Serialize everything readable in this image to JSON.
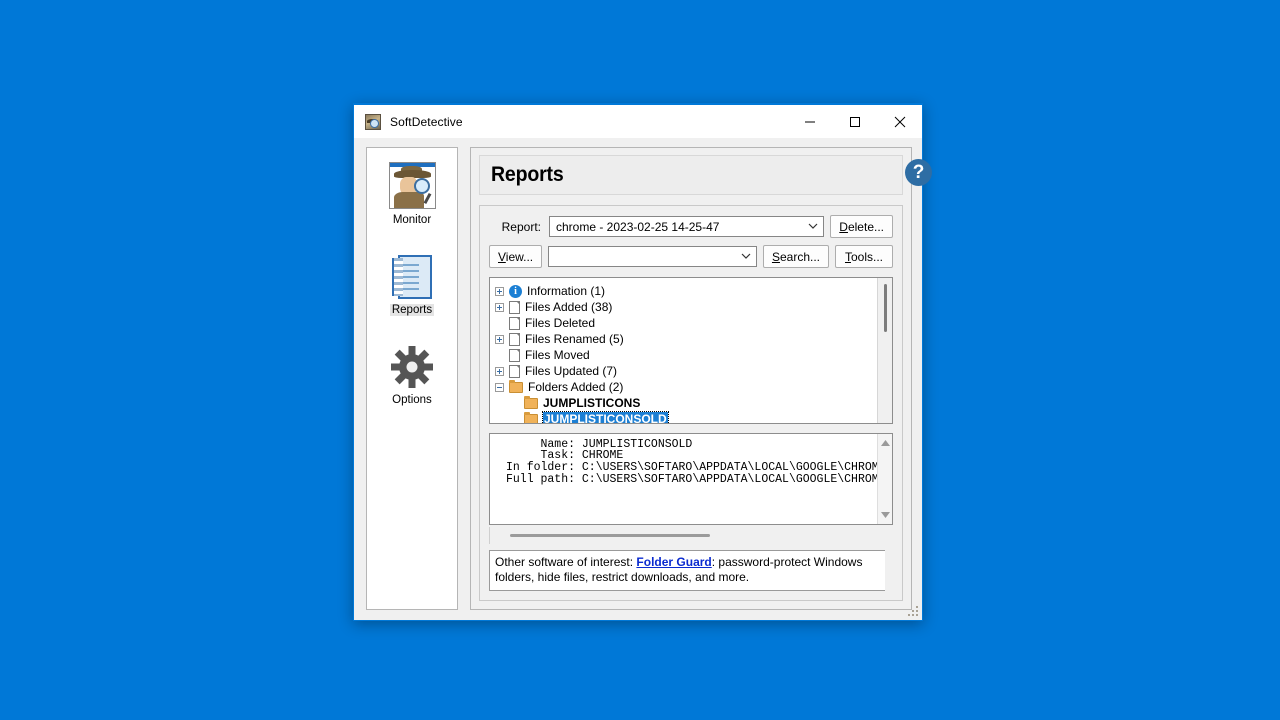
{
  "window": {
    "title": "SoftDetective",
    "icon": "detective-icon",
    "minimize_label": "Minimize",
    "maximize_label": "Maximize",
    "close_label": "Close"
  },
  "sidebar": {
    "items": [
      {
        "label": "Monitor",
        "icon": "detective-icon",
        "selected": false
      },
      {
        "label": "Reports",
        "icon": "notepad-icon",
        "selected": true
      },
      {
        "label": "Options",
        "icon": "gear-icon",
        "selected": false
      }
    ]
  },
  "header": {
    "title": "Reports",
    "help_label": "?"
  },
  "toolbar": {
    "report_label": "Report:",
    "report_value": "chrome - 2023-02-25 14-25-47",
    "delete_label": "Delete...",
    "view_label": "View...",
    "filter_value": "",
    "search_label": "Search...",
    "tools_label": "Tools..."
  },
  "tree": {
    "rows": [
      {
        "expander": "plus",
        "icon": "info-icon",
        "label": "Information (1)",
        "indent": 0,
        "bold": false,
        "selected": false
      },
      {
        "expander": "plus",
        "icon": "doc-icon",
        "label": "Files Added (38)",
        "indent": 0,
        "bold": false,
        "selected": false
      },
      {
        "expander": "none",
        "icon": "doc-icon",
        "label": "Files Deleted",
        "indent": 0,
        "bold": false,
        "selected": false
      },
      {
        "expander": "plus",
        "icon": "doc-icon",
        "label": "Files Renamed (5)",
        "indent": 0,
        "bold": false,
        "selected": false
      },
      {
        "expander": "none",
        "icon": "doc-icon",
        "label": "Files Moved",
        "indent": 0,
        "bold": false,
        "selected": false
      },
      {
        "expander": "plus",
        "icon": "doc-icon",
        "label": "Files Updated (7)",
        "indent": 0,
        "bold": false,
        "selected": false
      },
      {
        "expander": "minus",
        "icon": "folder-icon",
        "label": "Folders Added (2)",
        "indent": 0,
        "bold": false,
        "selected": false
      },
      {
        "expander": "none",
        "icon": "folder-icon",
        "label": "JUMPLISTICONS",
        "indent": 1,
        "bold": true,
        "selected": false
      },
      {
        "expander": "none",
        "icon": "folder-icon",
        "label": "JUMPLISTICONSOLD",
        "indent": 1,
        "bold": true,
        "selected": true
      }
    ]
  },
  "details": {
    "lines": [
      {
        "key": "Name:",
        "value": "JUMPLISTICONSOLD"
      },
      {
        "key": "Task:",
        "value": "CHROME"
      },
      {
        "key": "In folder:",
        "value": "C:\\USERS\\SOFTARO\\APPDATA\\LOCAL\\GOOGLE\\CHROME"
      },
      {
        "key": "Full path:",
        "value": "C:\\USERS\\SOFTARO\\APPDATA\\LOCAL\\GOOGLE\\CHROME"
      }
    ]
  },
  "promo": {
    "prefix": "Other software of interest: ",
    "link": "Folder Guard",
    "suffix": ": password-protect Windows folders, hide files, restrict downloads, and more."
  },
  "colors": {
    "desktop": "#0078d7",
    "accent": "#0078d7",
    "selection": "#1c7fd4",
    "link": "#0a2ad0",
    "help_button": "#2e6da4",
    "folder": "#f0b259"
  }
}
